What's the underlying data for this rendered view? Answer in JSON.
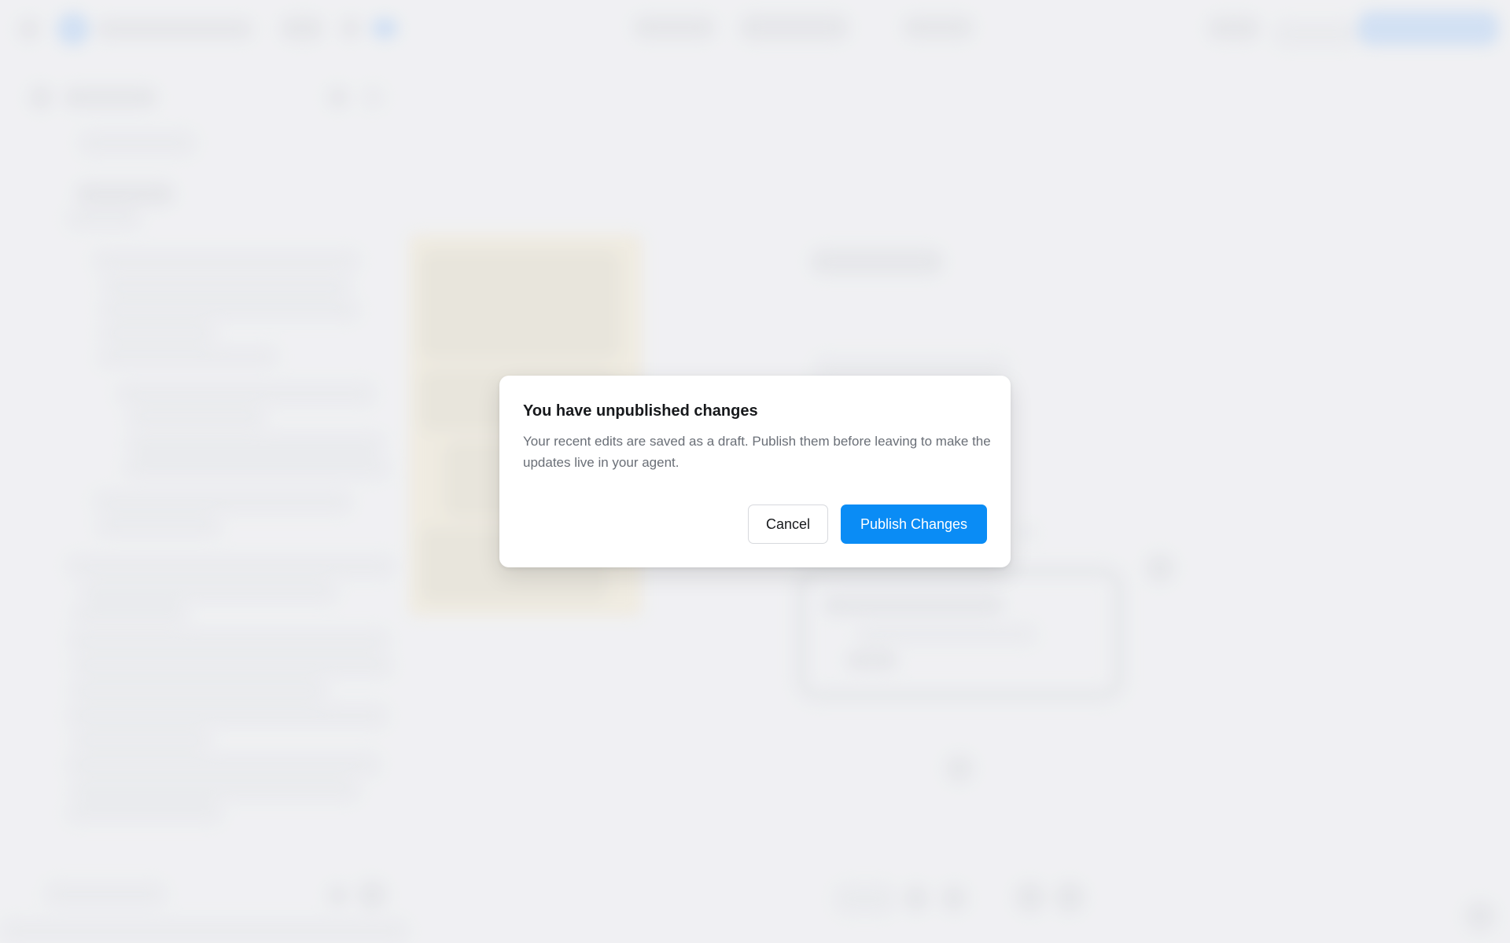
{
  "dialog": {
    "title": "You have unpublished changes",
    "body": "Your recent edits are saved as a draft. Publish them before leaving to make the updates live in your agent.",
    "cancel_label": "Cancel",
    "publish_label": "Publish Changes"
  },
  "colors": {
    "primary": "#0a8cf5",
    "backdrop": "#f0f1f3",
    "dialog_bg": "#ffffff",
    "title_text": "#17191c",
    "body_text": "#6a6f77"
  }
}
